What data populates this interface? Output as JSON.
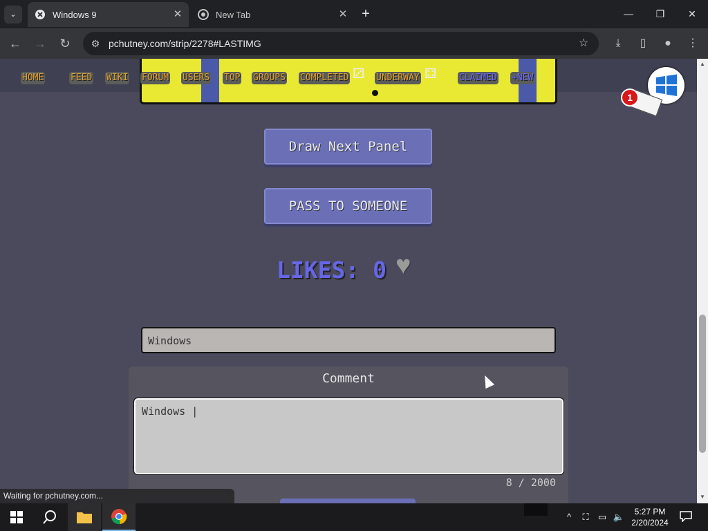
{
  "browser": {
    "tabs": [
      {
        "title": "Windows 9",
        "active": true
      },
      {
        "title": "New Tab",
        "active": false
      }
    ],
    "url": "pchutney.com/strip/2278#LASTIMG",
    "status": "Waiting for pchutney.com..."
  },
  "site_nav": {
    "links": [
      "HOME",
      "FEED",
      "WIKI",
      "FORUM",
      "USERS",
      "TOP",
      "GROUPS",
      "COMPLETED",
      "UNDERWAY",
      "CLAIMED",
      "+NEW"
    ]
  },
  "notification": {
    "count": "1"
  },
  "actions": {
    "draw_next": "Draw Next Panel",
    "pass": "PASS TO SOMEONE"
  },
  "likes": {
    "label": "LIKES: 0",
    "heart": "♥"
  },
  "title_input": {
    "value": "Windows"
  },
  "comment": {
    "heading": "Comment",
    "value": "Windows |",
    "counter": "8 / 2000"
  },
  "taskbar": {
    "time": "5:27 PM",
    "date": "2/20/2024"
  },
  "colors": {
    "page_bg": "#4a4a5c",
    "button": "#6a6fb6",
    "likes": "#6666e6",
    "nav_orange": "#e0a030",
    "comic_yellow": "#e9e934"
  }
}
